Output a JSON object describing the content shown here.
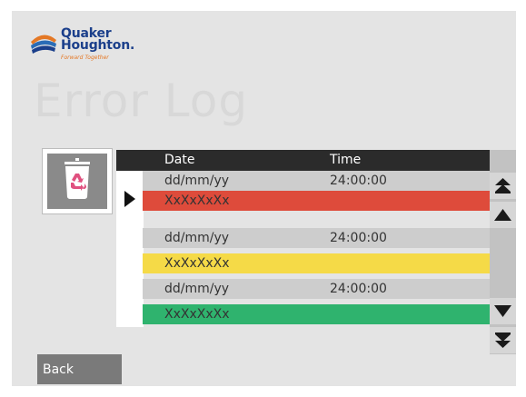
{
  "brand": {
    "line1": "Quaker",
    "line2": "Houghton.",
    "tagline": "Forward Together"
  },
  "page": {
    "title": "Error Log"
  },
  "table": {
    "columns": [
      "Date",
      "Time"
    ],
    "rows": [
      {
        "date": "dd/mm/yy",
        "time": "24:00:00",
        "message": "XxXxXxXx",
        "color": "#de4b3b"
      },
      {
        "date": "dd/mm/yy",
        "time": "24:00:00",
        "message": "XxXxXxXx",
        "color": "#f5da47"
      },
      {
        "date": "dd/mm/yy",
        "time": "24:00:00",
        "message": "XxXxXxXx",
        "color": "#2fb36e"
      }
    ]
  },
  "colors": {
    "error": "#de4b3b",
    "warning": "#f5da47",
    "ok": "#2fb36e",
    "header": "#2b2b2b",
    "recycle": "#e0507f"
  },
  "icons": {
    "clear_log": "trash-recycle-icon",
    "selected_row": "triangle-right-icon",
    "scroll_top": "double-chevron-up-icon",
    "scroll_up": "triangle-up-icon",
    "scroll_down": "triangle-down-icon",
    "scroll_bottom": "double-chevron-down-icon"
  },
  "footer": {
    "back_label": "Back"
  }
}
